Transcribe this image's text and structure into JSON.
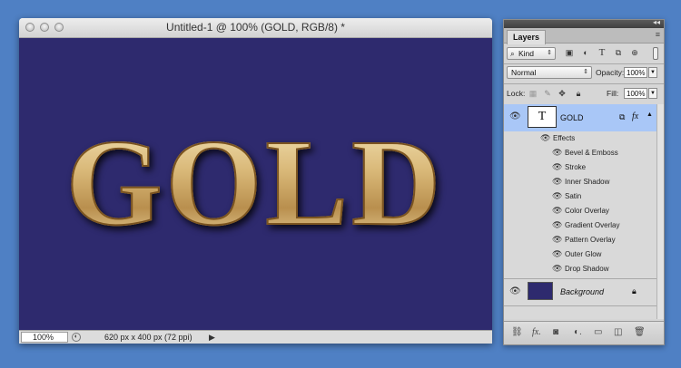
{
  "document": {
    "title": "Untitled-1 @ 100% (GOLD, RGB/8) *",
    "canvas_text": "GOLD",
    "canvas_color": "#2e2a6e",
    "status": {
      "zoom": "100%",
      "info": "620 px x 400 px (72 ppi)",
      "arrow": "▶"
    }
  },
  "panel": {
    "collapse_icon": "◂◂",
    "tab": "Layers",
    "menu_icon": "≡",
    "filter": {
      "kind_label": "Kind",
      "kind_icon": "search-icon"
    },
    "filter_buttons": [
      "▣",
      "◐",
      "T",
      "⧉",
      "⊕"
    ],
    "blend_mode": "Normal",
    "opacity_label": "Opacity:",
    "opacity_value": "100%",
    "lock_label": "Lock:",
    "fill_label": "Fill:",
    "fill_value": "100%",
    "layers": [
      {
        "name": "GOLD",
        "thumb": "T",
        "fx": "fx",
        "effects_label": "Effects",
        "effects": [
          "Bevel & Emboss",
          "Stroke",
          "Inner Shadow",
          "Satin",
          "Color Overlay",
          "Gradient Overlay",
          "Pattern Overlay",
          "Outer Glow",
          "Drop Shadow"
        ]
      },
      {
        "name": "Background"
      }
    ],
    "bottom_icons": [
      "link-icon",
      "fx-icon",
      "mask-icon",
      "adjustment-icon",
      "folder-icon",
      "new-layer-icon",
      "trash-icon"
    ]
  },
  "colors": {
    "desktop": "#4f80c4",
    "selection": "#a9c7f7",
    "gold": "#d8bc84"
  }
}
